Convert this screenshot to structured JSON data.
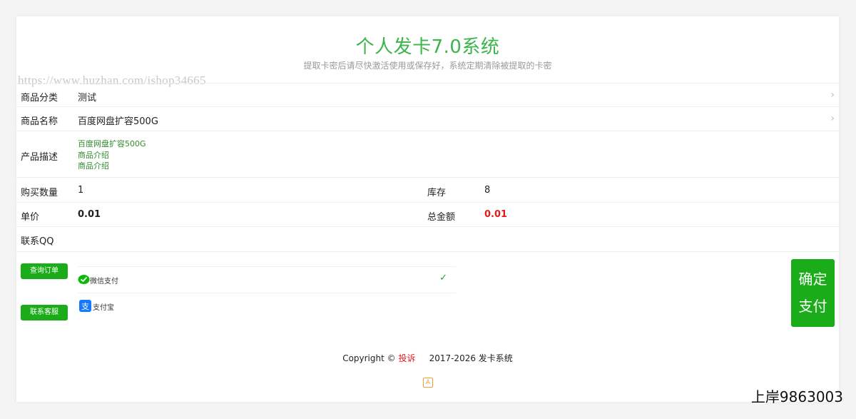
{
  "header": {
    "title": "个人发卡7.0系统",
    "subtitle": "提取卡密后请尽快激活使用或保存好，系统定期清除被提取的卡密"
  },
  "watermark": "https://www.huzhan.com/ishop34665",
  "form": {
    "category": {
      "label": "商品分类",
      "value": "测试"
    },
    "product": {
      "label": "商品名称",
      "value": "百度网盘扩容500G"
    },
    "description": {
      "label": "产品描述",
      "lines": [
        "百度网盘扩容500G",
        "商品介绍",
        "商品介绍"
      ]
    },
    "quantity": {
      "label": "购买数量",
      "value": "1"
    },
    "stock": {
      "label": "库存",
      "value": "8"
    },
    "unit_price": {
      "label": "单价",
      "value": "0.01"
    },
    "total": {
      "label": "总金额",
      "value": "0.01"
    },
    "qq": {
      "label": "联系QQ",
      "value": ""
    }
  },
  "actions": {
    "query_order": "查询订单",
    "contact_service": "联系客服",
    "confirm_line1": "确定",
    "confirm_line2": "支付"
  },
  "payment": {
    "options": [
      {
        "name": "微信支付",
        "selected": true,
        "icon": "wechat-pay-icon",
        "color": "#09bb07"
      },
      {
        "name": "支付宝",
        "selected": false,
        "icon": "alipay-icon",
        "color": "#1677ff"
      }
    ],
    "check_glyph": "✓"
  },
  "footer": {
    "copyright": "Copyright ©",
    "complain": "投诉",
    "years": "2017-2026 发卡系统",
    "badge": "A"
  },
  "corner_text": "上岸9863003",
  "colors": {
    "accent": "#3bb54a",
    "button": "#1aad19",
    "price_red": "#e21b1b"
  }
}
